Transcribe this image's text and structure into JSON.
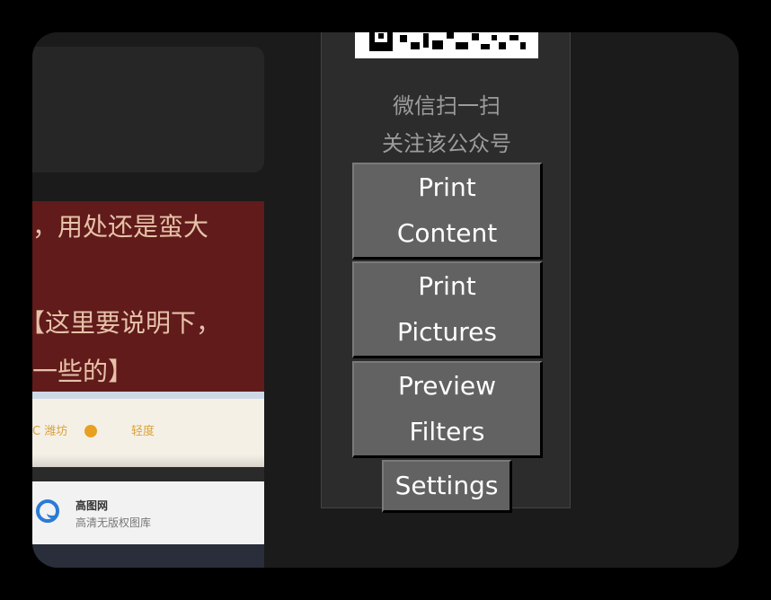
{
  "article": {
    "line1": "，用处还是蛮大",
    "line2": "【这里要说明下，",
    "line3": "一些的】"
  },
  "weather_widget": {
    "city": "C 潍坊",
    "air": "轻度"
  },
  "site_card": {
    "brand": "高图网",
    "tagline": "高清无版权图库"
  },
  "panel": {
    "qr_caption_1": "微信扫一扫",
    "qr_caption_2": "关注该公众号",
    "buttons": {
      "print_content": [
        "Print",
        "Content"
      ],
      "print_pictures": [
        "Print",
        "Pictures"
      ],
      "preview_filters": [
        "Preview",
        "Filters"
      ],
      "settings": "Settings"
    }
  },
  "colors": {
    "window_bg": "#1b1b1b",
    "panel_bg": "#2c2c2c",
    "button_bg": "#626262",
    "article_bg": "#611b1b",
    "article_text": "#e6c2a8"
  }
}
